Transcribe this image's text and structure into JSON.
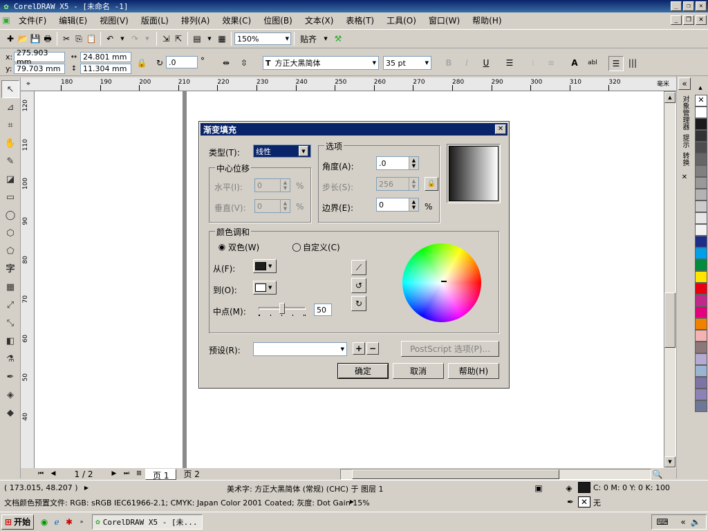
{
  "app": {
    "title": "CorelDRAW X5 - [未命名 -1]"
  },
  "menu": [
    "文件(F)",
    "编辑(E)",
    "视图(V)",
    "版面(L)",
    "排列(A)",
    "效果(C)",
    "位图(B)",
    "文本(X)",
    "表格(T)",
    "工具(O)",
    "窗口(W)",
    "帮助(H)"
  ],
  "toolbar": {
    "zoom": "150%",
    "snap_label": "贴齐"
  },
  "props": {
    "x": "275.903 mm",
    "y": "79.703 mm",
    "w": "24.801 mm",
    "h": "11.304 mm",
    "angle": ".0",
    "angle_unit": "°",
    "font": "方正大黑简体",
    "size": "35 pt"
  },
  "ruler": {
    "h_ticks": [
      "180",
      "190",
      "200",
      "210",
      "220",
      "230",
      "240",
      "250",
      "260",
      "270",
      "280",
      "290",
      "300",
      "310",
      "320"
    ],
    "h_unit": "毫米",
    "v_ticks": [
      "120",
      "110",
      "100",
      "90",
      "80",
      "70",
      "60",
      "50",
      "40"
    ]
  },
  "dialog": {
    "title": "渐变填充",
    "type_label": "类型(T):",
    "type_value": "线性",
    "center_group": "中心位移",
    "horiz_label": "水平(I):",
    "horiz_value": "0",
    "vert_label": "垂直(V):",
    "vert_value": "0",
    "pct": "%",
    "options_group": "选项",
    "angle_label": "角度(A):",
    "angle_value": ".0",
    "steps_label": "步长(S):",
    "steps_value": "256",
    "edge_label": "边界(E):",
    "edge_value": "0",
    "blend_group": "颜色调和",
    "two_color": "双色(W)",
    "custom": "自定义(C)",
    "from_label": "从(F):",
    "to_label": "到(O):",
    "mid_label": "中点(M):",
    "mid_value": "50",
    "preset_label": "预设(R):",
    "postscript": "PostScript 选项(P)...",
    "ok": "确定",
    "cancel": "取消",
    "help": "帮助(H)",
    "colors": {
      "from": "#1e1e1e",
      "to": "#ffffff"
    }
  },
  "pages": {
    "counter": "1 / 2",
    "tabs": [
      "页 1",
      "页 2"
    ]
  },
  "status": {
    "coords": "( 173.015, 48.207 )",
    "info": "美术字: 方正大黑简体 (常规) (CHC) 于 图层 1",
    "fill": "C: 0 M: 0 Y: 0 K: 100",
    "outline": "无",
    "profile": "文档颜色预置文件: RGB: sRGB IEC61966-2.1; CMYK: Japan Color 2001 Coated; 灰度: Dot Gain 15%"
  },
  "docker": [
    "对象管理器",
    "提示",
    "转换"
  ],
  "taskbar": {
    "start": "开始",
    "task": "CorelDRAW X5 - [未..."
  },
  "palette": [
    "#ffffff",
    "#1a1a1a",
    "#333333",
    "#4d4d4d",
    "#666666",
    "#808080",
    "#999999",
    "#b3b3b3",
    "#cccccc",
    "#e6e6e6",
    "#f2f2f2",
    "#1d2e8a",
    "#00a0e9",
    "#008c3c",
    "#ffe600",
    "#e60012",
    "#c0288a",
    "#e4007f",
    "#f08200",
    "#f5b2b2",
    "#8c7878",
    "#b4aad2",
    "#9bb4d2",
    "#7d73a5",
    "#8c82b4",
    "#6e7896"
  ]
}
